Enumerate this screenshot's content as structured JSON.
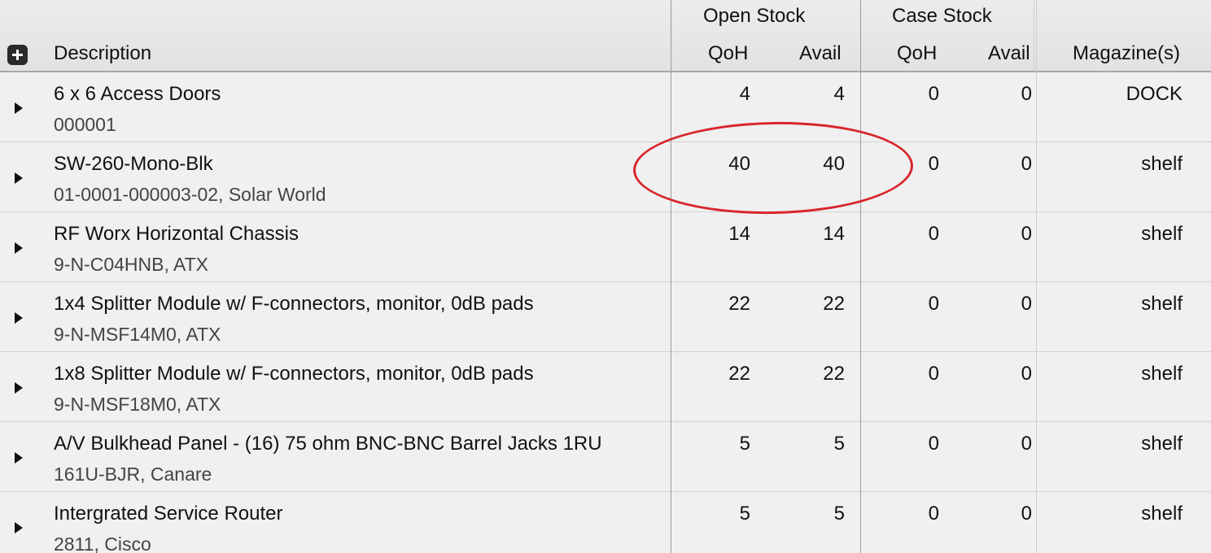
{
  "header": {
    "group_open": "Open Stock",
    "group_case": "Case Stock",
    "description": "Description",
    "open_qoh": "QoH",
    "open_avail": "Avail",
    "case_qoh": "QoH",
    "case_avail": "Avail",
    "magazines": "Magazine(s)",
    "add_icon": "plus-square-icon"
  },
  "rows": [
    {
      "title": "6 x 6 Access Doors",
      "subtitle": "000001",
      "open_qoh": "4",
      "open_avail": "4",
      "case_qoh": "0",
      "case_avail": "0",
      "magazine": "DOCK"
    },
    {
      "title": "SW-260-Mono-Blk",
      "subtitle": "01-0001-000003-02, Solar World",
      "open_qoh": "40",
      "open_avail": "40",
      "case_qoh": "0",
      "case_avail": "0",
      "magazine": "shelf"
    },
    {
      "title": "RF Worx Horizontal Chassis",
      "subtitle": "9-N-C04HNB, ATX",
      "open_qoh": "14",
      "open_avail": "14",
      "case_qoh": "0",
      "case_avail": "0",
      "magazine": "shelf"
    },
    {
      "title": "1x4 Splitter Module w/ F-connectors, monitor, 0dB pads",
      "subtitle": "9-N-MSF14M0, ATX",
      "open_qoh": "22",
      "open_avail": "22",
      "case_qoh": "0",
      "case_avail": "0",
      "magazine": "shelf"
    },
    {
      "title": "1x8 Splitter Module w/ F-connectors, monitor, 0dB pads",
      "subtitle": "9-N-MSF18M0, ATX",
      "open_qoh": "22",
      "open_avail": "22",
      "case_qoh": "0",
      "case_avail": "0",
      "magazine": "shelf"
    },
    {
      "title": "A/V Bulkhead Panel - (16) 75 ohm BNC-BNC Barrel Jacks 1RU",
      "subtitle": "161U-BJR, Canare",
      "open_qoh": "5",
      "open_avail": "5",
      "case_qoh": "0",
      "case_avail": "0",
      "magazine": "shelf"
    },
    {
      "title": "Intergrated Service Router",
      "subtitle": "2811, Cisco",
      "open_qoh": "5",
      "open_avail": "5",
      "case_qoh": "0",
      "case_avail": "0",
      "magazine": "shelf"
    }
  ],
  "colors": {
    "annotation": "#d8262b",
    "header_bg": "#e6e6e6",
    "row_bg": "#f0f0f0"
  }
}
